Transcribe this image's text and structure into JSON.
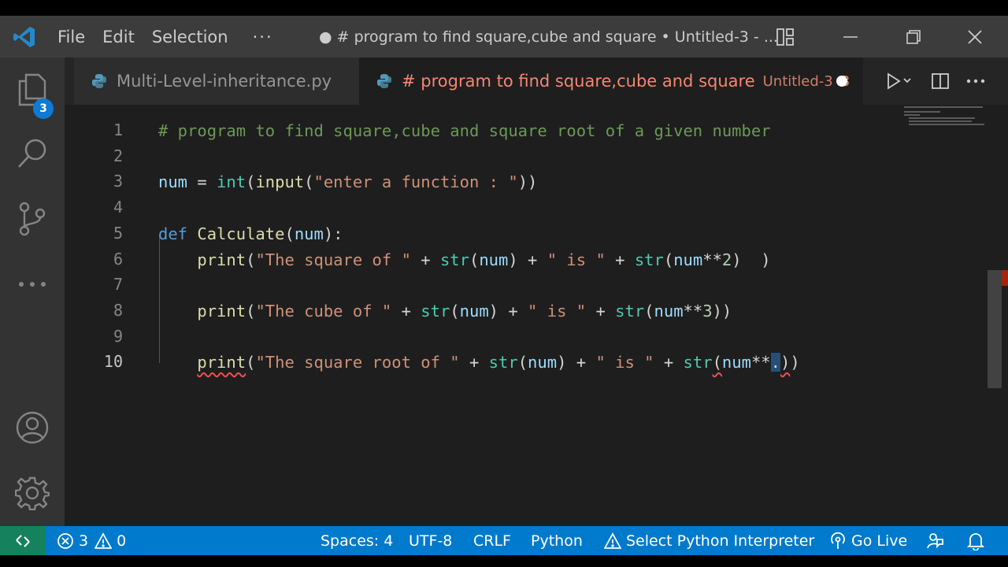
{
  "titlebar": {
    "menus": [
      "File",
      "Edit",
      "Selection"
    ],
    "more": "···",
    "title": "● # program to find square,cube and square • Untitled-3 - ..."
  },
  "activity": {
    "explorer_badge": "3"
  },
  "tabs": [
    {
      "label": "Multi-Level-inheritance.py"
    },
    {
      "label": "# program to find square,cube and square",
      "description": "Untitled-3",
      "problems": "3"
    }
  ],
  "editor": {
    "line_numbers": [
      "1",
      "2",
      "3",
      "4",
      "5",
      "6",
      "7",
      "8",
      "9",
      "10"
    ],
    "active_line": "10",
    "lines": [
      [
        [
          "c-comment",
          "# program to find square,cube and square root of a given number"
        ]
      ],
      [],
      [
        [
          "c-var",
          "num"
        ],
        [
          "c-op",
          " = "
        ],
        [
          "c-builtin",
          "int"
        ],
        [
          "c-op",
          "("
        ],
        [
          "c-fn",
          "input"
        ],
        [
          "c-op",
          "("
        ],
        [
          "c-str",
          "\"enter a function : \""
        ],
        [
          "c-op",
          "))"
        ]
      ],
      [],
      [
        [
          "c-kw",
          "def "
        ],
        [
          "c-fn",
          "Calculate"
        ],
        [
          "c-op",
          "("
        ],
        [
          "c-var",
          "num"
        ],
        [
          "c-op",
          "):"
        ]
      ],
      [
        [
          "c-op",
          "    "
        ],
        [
          "c-fn",
          "print"
        ],
        [
          "c-op",
          "("
        ],
        [
          "c-str",
          "\"The square of \""
        ],
        [
          "c-op",
          " + "
        ],
        [
          "c-builtin",
          "str"
        ],
        [
          "c-op",
          "("
        ],
        [
          "c-var",
          "num"
        ],
        [
          "c-op",
          ") + "
        ],
        [
          "c-str",
          "\" is \""
        ],
        [
          "c-op",
          " + "
        ],
        [
          "c-builtin",
          "str"
        ],
        [
          "c-op",
          "("
        ],
        [
          "c-var",
          "num"
        ],
        [
          "c-op",
          "**"
        ],
        [
          "c-num",
          "2"
        ],
        [
          "c-op",
          ")  )"
        ]
      ],
      [],
      [
        [
          "c-op",
          "    "
        ],
        [
          "c-fn",
          "print"
        ],
        [
          "c-op",
          "("
        ],
        [
          "c-str",
          "\"The cube of \""
        ],
        [
          "c-op",
          " + "
        ],
        [
          "c-builtin",
          "str"
        ],
        [
          "c-op",
          "("
        ],
        [
          "c-var",
          "num"
        ],
        [
          "c-op",
          ") + "
        ],
        [
          "c-str",
          "\" is \""
        ],
        [
          "c-op",
          " + "
        ],
        [
          "c-builtin",
          "str"
        ],
        [
          "c-op",
          "("
        ],
        [
          "c-var",
          "num"
        ],
        [
          "c-op",
          "**"
        ],
        [
          "c-num",
          "3"
        ],
        [
          "c-op",
          "))"
        ]
      ],
      [],
      [
        [
          "c-op",
          "    "
        ],
        [
          "c-fn squiggle",
          "print"
        ],
        [
          "c-op",
          "("
        ],
        [
          "c-str",
          "\"The square root of \""
        ],
        [
          "c-op",
          " + "
        ],
        [
          "c-builtin",
          "str"
        ],
        [
          "c-op",
          "("
        ],
        [
          "c-var",
          "num"
        ],
        [
          "c-op",
          ") + "
        ],
        [
          "c-str",
          "\" is \""
        ],
        [
          "c-op",
          " + "
        ],
        [
          "c-builtin",
          "str"
        ],
        [
          "c-op squiggle",
          "("
        ],
        [
          "c-var",
          "num"
        ],
        [
          "c-op",
          "**"
        ],
        [
          "c-op cursor-sel",
          "."
        ],
        [
          "c-op squiggle",
          ")"
        ],
        [
          "c-op",
          ")"
        ]
      ]
    ]
  },
  "statusbar": {
    "errors": "3",
    "warnings": "0",
    "spaces": "Spaces: 4",
    "encoding": "UTF-8",
    "eol": "CRLF",
    "language": "Python",
    "interpreter": "Select Python Interpreter",
    "live": "Go Live"
  },
  "colors": {
    "accent": "#007acc",
    "remote": "#16825d",
    "tab_modified": "#f48771"
  }
}
